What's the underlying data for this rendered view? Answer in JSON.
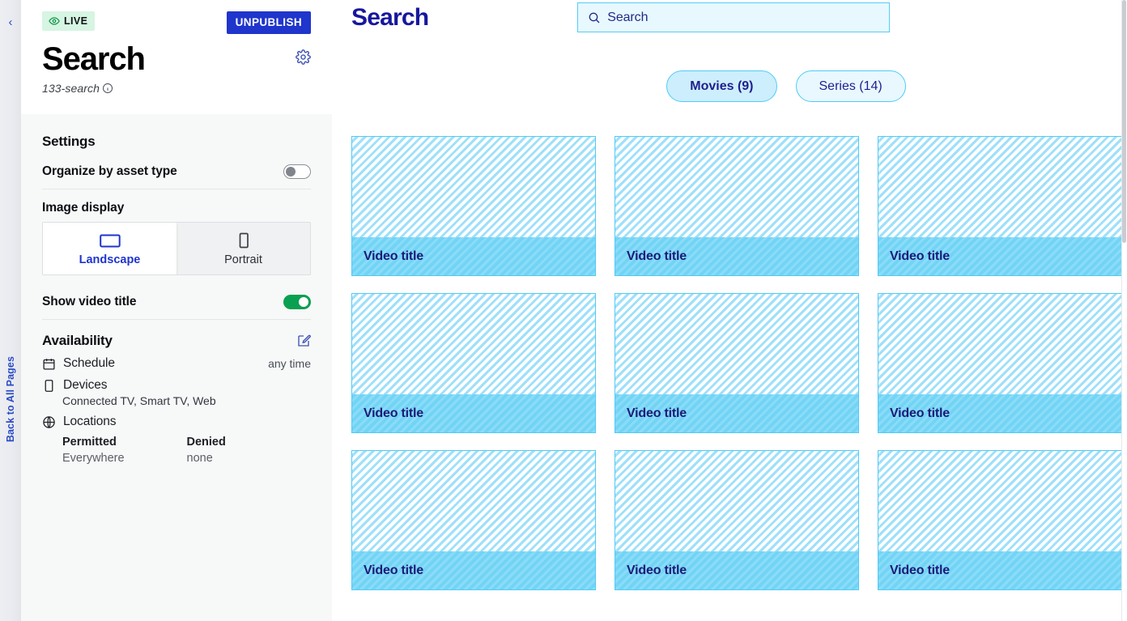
{
  "rail": {
    "collapse_icon": "chevron-left-icon",
    "back_label": "Back to All Pages"
  },
  "sidebar": {
    "status_badge": {
      "label": "LIVE",
      "icon": "eye-icon",
      "bg_color": "#d6f5e2",
      "icon_color": "#0a8f43"
    },
    "unpublish_label": "UNPUBLISH",
    "unpublish_color": "#1f35cc",
    "page_title": "Search",
    "slug": "133-search",
    "info_icon": "info-icon",
    "gear_icon": "gear-icon",
    "settings": {
      "heading": "Settings",
      "organize_label": "Organize by asset type",
      "organize_state": "off",
      "image_display_label": "Image display",
      "image_display_options": [
        {
          "label": "Landscape",
          "icon": "landscape-rect-icon",
          "active": true
        },
        {
          "label": "Portrait",
          "icon": "portrait-rect-icon",
          "active": false
        }
      ],
      "show_video_title_label": "Show video title",
      "show_video_title_state": "on",
      "toggle_on_color": "#0aa051"
    },
    "availability": {
      "heading": "Availability",
      "edit_icon": "edit-icon",
      "schedule_label": "Schedule",
      "schedule_icon": "calendar-icon",
      "schedule_value": "any time",
      "devices_label": "Devices",
      "devices_icon": "device-icon",
      "devices_value": "Connected TV, Smart TV, Web",
      "locations_label": "Locations",
      "locations_icon": "globe-icon",
      "permitted_header": "Permitted",
      "permitted_value": "Everywhere",
      "denied_header": "Denied",
      "denied_value": "none"
    }
  },
  "preview": {
    "title": "Search",
    "title_color": "#17179e",
    "search": {
      "icon": "search-icon",
      "placeholder": "Search",
      "value": "",
      "border_color": "#52cdf7",
      "bg_color": "#e8f8ff"
    },
    "tabs": [
      {
        "label": "Movies (9)",
        "active": true
      },
      {
        "label": "Series (14)",
        "active": false
      }
    ],
    "accent_color": "#4fcbf6",
    "cards": [
      {
        "title": "Video title"
      },
      {
        "title": "Video title"
      },
      {
        "title": "Video title"
      },
      {
        "title": "Video title"
      },
      {
        "title": "Video title"
      },
      {
        "title": "Video title"
      },
      {
        "title": "Video title"
      },
      {
        "title": "Video title"
      },
      {
        "title": "Video title"
      }
    ]
  }
}
